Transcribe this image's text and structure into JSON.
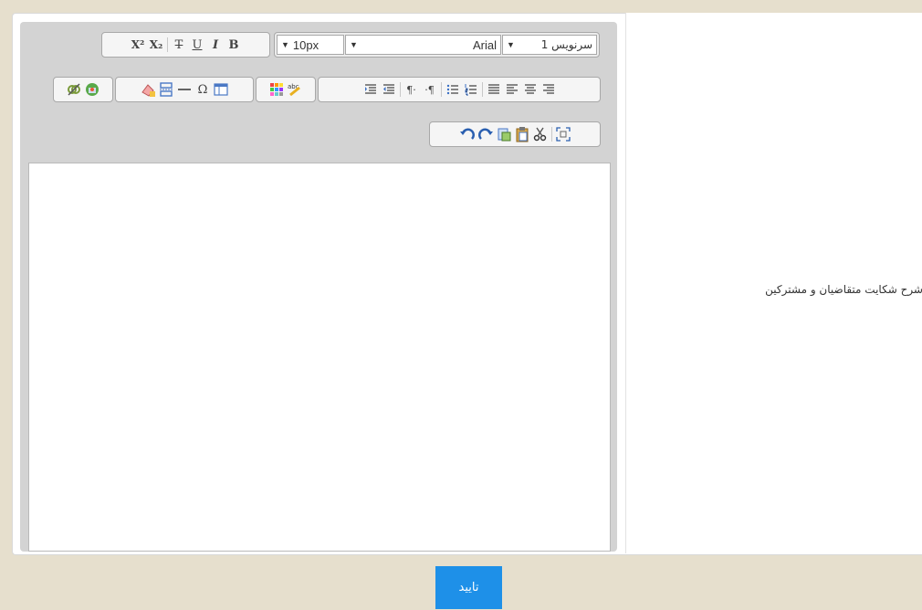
{
  "form": {
    "field_label": "شرح شکایت متقاضیان و مشترکین",
    "submit_label": "تایید"
  },
  "toolbar": {
    "bold": "B",
    "italic": "I",
    "underline": "U",
    "strikethrough": "T",
    "subscript": "X₂",
    "superscript": "X²",
    "size_value": "10px",
    "font_value": "Arial",
    "format_value": "سرنویس 1",
    "special_char": "Ω",
    "pilcrow_ltr": "¶·",
    "pilcrow_rtl": "·¶"
  },
  "colors": {
    "page_bg": "#e6dfcd",
    "editor_bg": "#d3d3d3",
    "submit_bg": "#1e90e8"
  },
  "editor_content": ""
}
